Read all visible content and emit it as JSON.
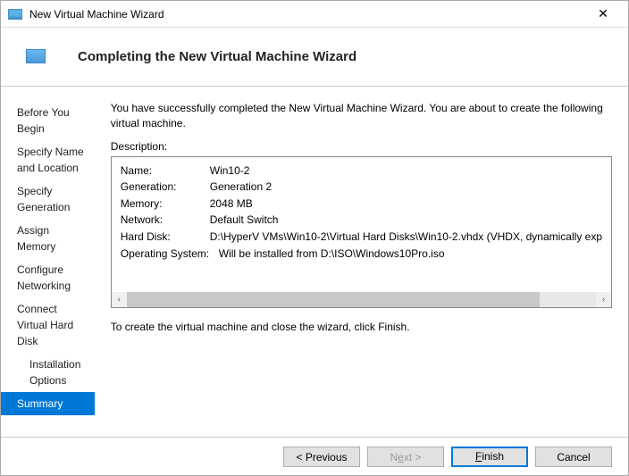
{
  "titlebar": {
    "title": "New Virtual Machine Wizard"
  },
  "header": {
    "title": "Completing the New Virtual Machine Wizard"
  },
  "sidebar": {
    "steps": [
      {
        "label": "Before You Begin"
      },
      {
        "label": "Specify Name and Location"
      },
      {
        "label": "Specify Generation"
      },
      {
        "label": "Assign Memory"
      },
      {
        "label": "Configure Networking"
      },
      {
        "label": "Connect Virtual Hard Disk"
      },
      {
        "label": "Installation Options"
      },
      {
        "label": "Summary"
      }
    ]
  },
  "main": {
    "intro": "You have successfully completed the New Virtual Machine Wizard. You are about to create the following virtual machine.",
    "description_label": "Description:",
    "rows": [
      {
        "key": "Name:",
        "val": "Win10-2"
      },
      {
        "key": "Generation:",
        "val": "Generation 2"
      },
      {
        "key": "Memory:",
        "val": "2048 MB"
      },
      {
        "key": "Network:",
        "val": "Default Switch"
      },
      {
        "key": "Hard Disk:",
        "val": "D:\\HyperV VMs\\Win10-2\\Virtual Hard Disks\\Win10-2.vhdx (VHDX, dynamically exp"
      },
      {
        "key": "Operating System:",
        "val": "Will be installed from D:\\ISO\\Windows10Pro.iso"
      }
    ],
    "instruction": "To create the virtual machine and close the wizard, click Finish."
  },
  "footer": {
    "previous": "< Previous",
    "next_pre": "N",
    "next_u": "e",
    "next_post": "xt >",
    "finish_u": "F",
    "finish_post": "inish",
    "cancel": "Cancel"
  }
}
